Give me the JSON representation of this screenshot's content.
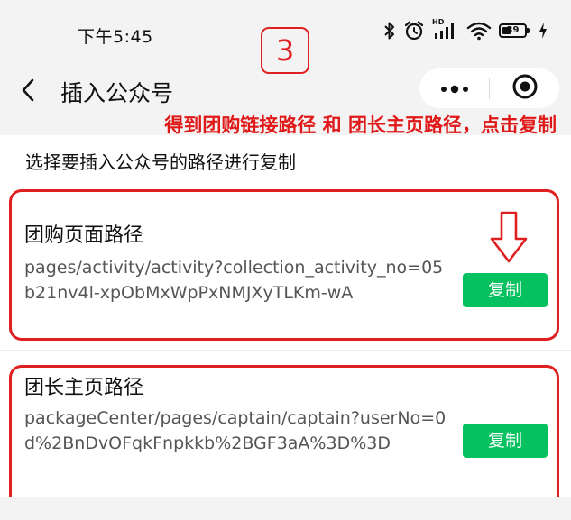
{
  "status_bar": {
    "time": "下午5:45",
    "icons": [
      "bluetooth-icon",
      "alarm-icon",
      "hd-signal-icon",
      "wifi-icon",
      "battery-icon",
      "charging-icon"
    ],
    "signal_label": "HD",
    "battery_level": "39",
    "battery_fraction": 0.39
  },
  "step_badge": "3",
  "nav": {
    "title": "插入公众号",
    "back_icon": "chevron-left-icon",
    "more_icon": "more-dots-icon",
    "close_icon": "target-circle-icon"
  },
  "annotation": "得到团购链接路径 和 团长主页路径，点击复制",
  "main": {
    "instruction": "选择要插入公众号的路径进行复制",
    "cards": [
      {
        "title": "团购页面路径",
        "path": "pages/activity/activity?collection_activity_no=05b21nv4l-xpObMxWpPxNMJXyTLKm-wA",
        "copy_label": "复制"
      },
      {
        "title": "团长主页路径",
        "path": "packageCenter/pages/captain/captain?userNo=0d%2BnDvOFqkFnpkkb%2BGF3aA%3D%3D",
        "copy_label": "复制"
      }
    ]
  },
  "colors": {
    "accent_green": "#07c160",
    "annotation_red": "#e02020",
    "background": "#f3f3f3"
  }
}
